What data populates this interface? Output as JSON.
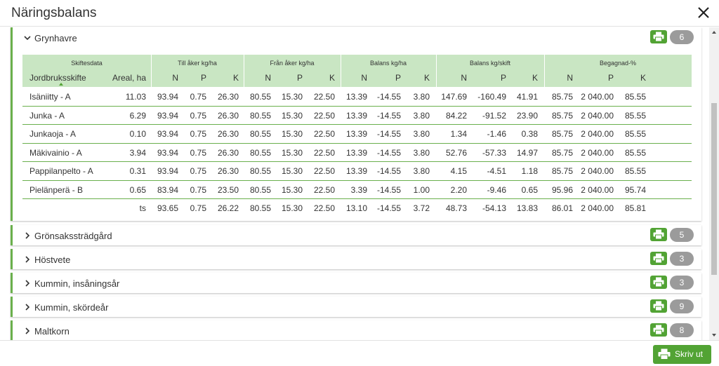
{
  "dialog": {
    "title": "Näringsbalans",
    "close_icon": "close-icon"
  },
  "footer": {
    "print_label": "Skriv ut"
  },
  "colors": {
    "accent": "#6ab04c",
    "button": "#52a334",
    "header_bg": "#c9e6c3",
    "badge": "#9b9b9b"
  },
  "expanded_section": {
    "title": "Grynhavre",
    "count": "6",
    "groups": [
      "Skiftesdata",
      "Till åker kg/ha",
      "Från åker kg/ha",
      "Balans kg/ha",
      "Balans kg/skift",
      "Begagnad-%"
    ],
    "columns": [
      "Jordbruksskifte",
      "Areal, ha",
      "N",
      "P",
      "K",
      "N",
      "P",
      "K",
      "N",
      "P",
      "K",
      "N",
      "P",
      "K",
      "N",
      "P",
      "K"
    ],
    "rows": [
      [
        "Isäniitty - A",
        "11.03",
        "93.94",
        "0.75",
        "26.30",
        "80.55",
        "15.30",
        "22.50",
        "13.39",
        "-14.55",
        "3.80",
        "147.69",
        "-160.49",
        "41.91",
        "85.75",
        "2 040.00",
        "85.55"
      ],
      [
        "Junka - A",
        "6.29",
        "93.94",
        "0.75",
        "26.30",
        "80.55",
        "15.30",
        "22.50",
        "13.39",
        "-14.55",
        "3.80",
        "84.22",
        "-91.52",
        "23.90",
        "85.75",
        "2 040.00",
        "85.55"
      ],
      [
        "Junkaoja - A",
        "0.10",
        "93.94",
        "0.75",
        "26.30",
        "80.55",
        "15.30",
        "22.50",
        "13.39",
        "-14.55",
        "3.80",
        "1.34",
        "-1.46",
        "0.38",
        "85.75",
        "2 040.00",
        "85.55"
      ],
      [
        "Mäkivainio - A",
        "3.94",
        "93.94",
        "0.75",
        "26.30",
        "80.55",
        "15.30",
        "22.50",
        "13.39",
        "-14.55",
        "3.80",
        "52.76",
        "-57.33",
        "14.97",
        "85.75",
        "2 040.00",
        "85.55"
      ],
      [
        "Pappilanpelto - A",
        "0.31",
        "93.94",
        "0.75",
        "26.30",
        "80.55",
        "15.30",
        "22.50",
        "13.39",
        "-14.55",
        "3.80",
        "4.15",
        "-4.51",
        "1.18",
        "85.75",
        "2 040.00",
        "85.55"
      ],
      [
        "Pielänperä - B",
        "0.65",
        "83.94",
        "0.75",
        "23.50",
        "80.55",
        "15.30",
        "22.50",
        "3.39",
        "-14.55",
        "1.00",
        "2.20",
        "-9.46",
        "0.65",
        "95.96",
        "2 040.00",
        "95.74"
      ]
    ],
    "totals": [
      "",
      "ts",
      "93.65",
      "0.75",
      "26.22",
      "80.55",
      "15.30",
      "22.50",
      "13.10",
      "-14.55",
      "3.72",
      "48.73",
      "-54.13",
      "13.83",
      "86.01",
      "2 040.00",
      "85.81"
    ]
  },
  "collapsed_sections": [
    {
      "title": "Grönsakssträdgård",
      "count": "5"
    },
    {
      "title": "Höstvete",
      "count": "3"
    },
    {
      "title": "Kummin, insåningsår",
      "count": "3"
    },
    {
      "title": "Kummin, skördeår",
      "count": "9"
    },
    {
      "title": "Maltkorn",
      "count": "8"
    }
  ]
}
